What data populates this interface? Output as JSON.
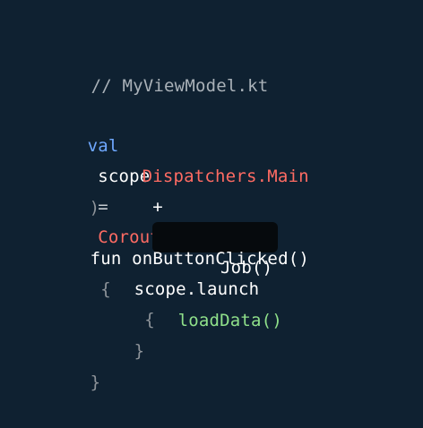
{
  "colors": {
    "background": "#0f2131",
    "comment": "#a9b1b8",
    "keyword": "#6fa8ff",
    "identifier": "#ffffff",
    "operator": "#c6cbd0",
    "class_call": "#ff6b63",
    "function_call": "#8fe08a",
    "brace": "#8d9399",
    "highlight_bg": "#060a0d"
  },
  "code": {
    "comment": "// MyViewModel.kt",
    "l1_keyword": "val",
    "l1_ident": "scope",
    "l1_op": "=",
    "l1_call": "CoroutineScope(",
    "l2_dispatchers": "Dispatchers.Main",
    "l2_plus": "+",
    "l2_job": "Job()",
    "l3_close": ")",
    "l4_fun": "fun onButtonClicked()",
    "l4_brace": "{",
    "l5_launch": "scope.launch",
    "l5_brace": "{",
    "l6_call": "loadData()",
    "l7_close": "}",
    "l8_close": "}"
  }
}
